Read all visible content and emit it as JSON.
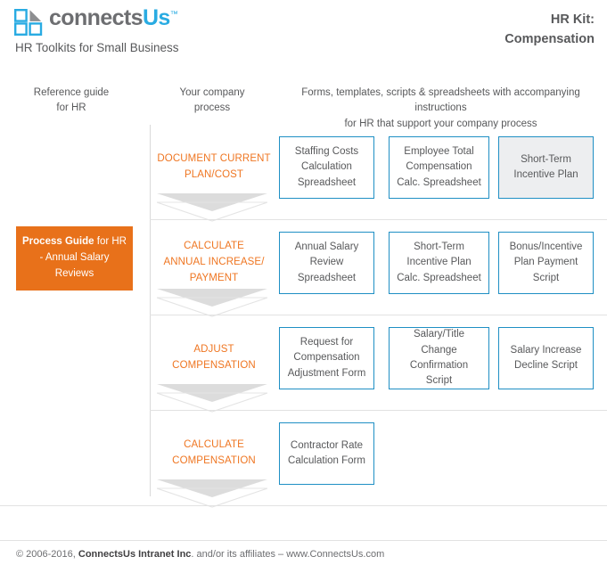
{
  "brand": {
    "logo_icon": "connectsus-squares-logo",
    "name_part1": "connects",
    "name_part2": "Us",
    "trademark": "™",
    "tagline": "HR Toolkits for Small Business"
  },
  "header": {
    "kit_label": "HR Kit:",
    "kit_name": "Compensation"
  },
  "colors": {
    "accent_orange": "#ef7622",
    "badge_orange": "#e8711a",
    "accent_blue": "#29abe2",
    "box_border_blue": "#1f8fc4",
    "shaded_box_fill": "#edeef0",
    "text_gray": "#58595b",
    "rule_gray": "#e2e2e2",
    "chevron_gray": "#dcdcdc"
  },
  "column_headers": [
    {
      "id": "reference-guide",
      "line1": "Reference guide",
      "line2": "for HR"
    },
    {
      "id": "company-process",
      "line1": "Your company",
      "line2": "process"
    },
    {
      "id": "forms-templates",
      "line1": "Forms, templates, scripts & spreadsheets with accompanying instructions",
      "line2": "for HR that support your company process"
    }
  ],
  "process_guide_badge": {
    "bold_text": "Process Guide",
    "rest_text": " for HR - Annual Salary Reviews"
  },
  "rows": [
    {
      "id": "document-current-plan-cost",
      "stage_lines": [
        "DOCUMENT CURRENT",
        "PLAN/COST"
      ],
      "documents": [
        {
          "id": "staffing-costs-calculation-spreadsheet",
          "lines": [
            "Staffing Costs",
            "Calculation",
            "Spreadsheet"
          ],
          "shaded": false
        },
        {
          "id": "employee-total-compensation-calc-spreadsheet",
          "lines": [
            "Employee Total",
            "Compensation",
            "Calc. Spreadsheet"
          ],
          "shaded": false
        },
        {
          "id": "short-term-incentive-plan",
          "lines": [
            "Short-Term",
            "Incentive Plan"
          ],
          "shaded": true
        }
      ]
    },
    {
      "id": "calculate-annual-increase-payment",
      "stage_lines": [
        "CALCULATE",
        "ANNUAL INCREASE/",
        "PAYMENT"
      ],
      "documents": [
        {
          "id": "annual-salary-review-spreadsheet",
          "lines": [
            "Annual Salary",
            "Review",
            "Spreadsheet"
          ],
          "shaded": false
        },
        {
          "id": "short-term-incentive-plan-calc-spreadsheet",
          "lines": [
            "Short-Term",
            "Incentive Plan",
            "Calc. Spreadsheet"
          ],
          "shaded": false
        },
        {
          "id": "bonus-incentive-plan-payment-script",
          "lines": [
            "Bonus/Incentive",
            "Plan Payment",
            "Script"
          ],
          "shaded": false
        }
      ]
    },
    {
      "id": "adjust-compensation",
      "stage_lines": [
        "ADJUST",
        "COMPENSATION"
      ],
      "documents": [
        {
          "id": "request-for-compensation-adjustment-form",
          "lines": [
            "Request for",
            "Compensation",
            "Adjustment Form"
          ],
          "shaded": false
        },
        {
          "id": "salary-title-change-confirmation-script",
          "lines": [
            "Salary/Title",
            "Change Confirmation",
            "Script"
          ],
          "shaded": false
        },
        {
          "id": "salary-increase-decline-script",
          "lines": [
            "Salary Increase",
            "Decline Script"
          ],
          "shaded": false
        }
      ]
    },
    {
      "id": "calculate-compensation",
      "stage_lines": [
        "CALCULATE",
        "COMPENSATION"
      ],
      "documents": [
        {
          "id": "contractor-rate-calculation-form",
          "lines": [
            "Contractor Rate",
            "Calculation Form"
          ],
          "shaded": false
        }
      ]
    }
  ],
  "footer": {
    "prefix": "© 2006-2016, ",
    "company": "ConnectsUs Intranet Inc",
    "suffix": ". and/or its affiliates – www.ConnectsUs.com"
  }
}
